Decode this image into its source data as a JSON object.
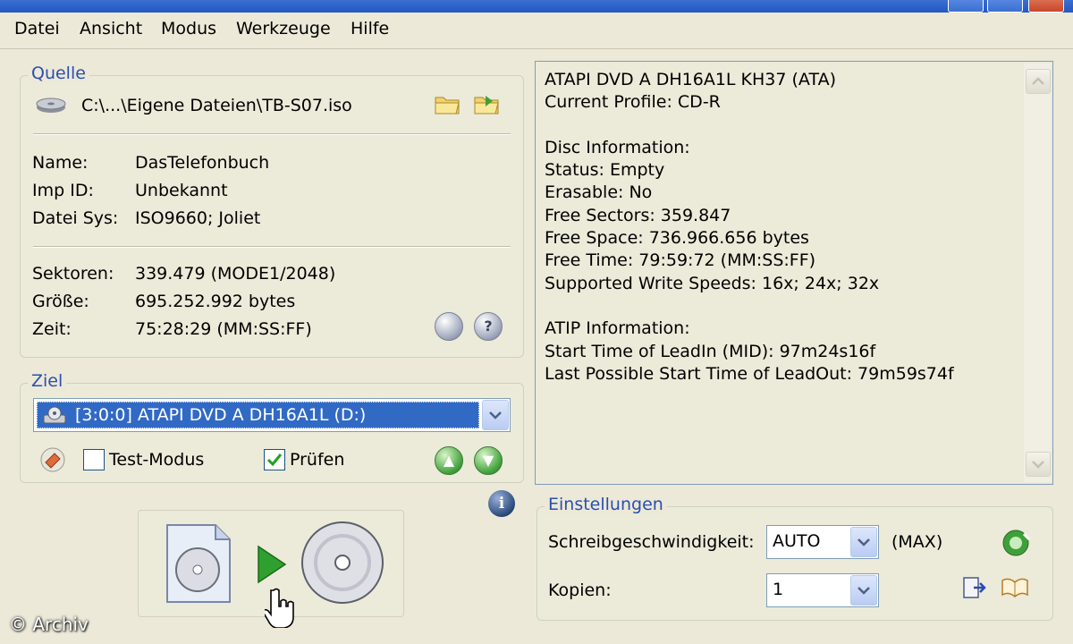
{
  "menu": [
    "Datei",
    "Ansicht",
    "Modus",
    "Werkzeuge",
    "Hilfe"
  ],
  "source": {
    "legend": "Quelle",
    "path": "C:\\...\\Eigene Dateien\\TB-S07.iso",
    "rows1": [
      {
        "label": "Name:",
        "value": "DasTelefonbuch"
      },
      {
        "label": "Imp ID:",
        "value": "Unbekannt"
      },
      {
        "label": "Datei Sys:",
        "value": "ISO9660; Joliet"
      }
    ],
    "rows2": [
      {
        "label": "Sektoren:",
        "value": "339.479 (MODE1/2048)"
      },
      {
        "label": "Größe:",
        "value": "695.252.992 bytes"
      },
      {
        "label": "Zeit:",
        "value": "75:28:29 (MM:SS:FF)"
      }
    ]
  },
  "target": {
    "legend": "Ziel",
    "drive": "[3:0:0] ATAPI DVD A  DH16A1L (D:)",
    "test_mode_label": "Test-Modus",
    "test_mode_checked": false,
    "verify_label": "Prüfen",
    "verify_checked": true
  },
  "info": {
    "lines": [
      "ATAPI DVD A  DH16A1L KH37 (ATA)",
      "Current Profile: CD-R",
      "",
      "Disc Information:",
      "Status: Empty",
      "Erasable: No",
      "Free Sectors: 359.847",
      "Free Space: 736.966.656 bytes",
      "Free Time: 79:59:72 (MM:SS:FF)",
      "Supported Write Speeds: 16x; 24x; 32x",
      "",
      "ATIP Information:",
      "Start Time of LeadIn (MID): 97m24s16f",
      "Last Possible Start Time of LeadOut: 79m59s74f"
    ]
  },
  "settings": {
    "legend": "Einstellungen",
    "speed_label": "Schreibgeschwindigkeit:",
    "speed_value": "AUTO",
    "speed_max": "(MAX)",
    "copies_label": "Kopien:",
    "copies_value": "1"
  },
  "watermark": "© Archiv",
  "colors": {
    "legend": "#2a4fb0",
    "play": "#2fa02f",
    "selection": "#316ac5"
  }
}
